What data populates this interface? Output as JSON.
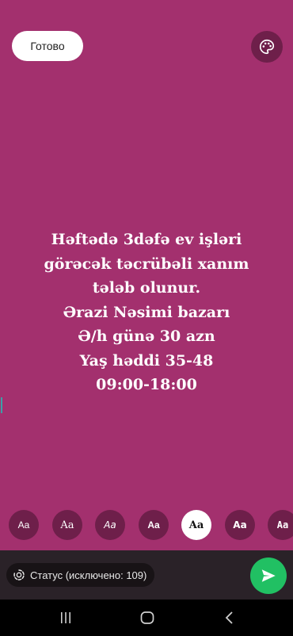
{
  "header": {
    "done_label": "Готово",
    "palette_icon": "palette-icon"
  },
  "status_text": {
    "lines": [
      "Həftədə 3dəfə ev işləri",
      "görəcək təcrübəli xanım",
      "tələb olunur.",
      "Ərazi Nəsimi bazarı",
      "Ə/h günə 30 azn",
      "Yaş həddi 35-48",
      "09:00-18:00"
    ],
    "background_color": "#a3306e",
    "text_color": "#ffffff"
  },
  "font_options": {
    "items": [
      "Aa",
      "Aa",
      "Aa",
      "Aa",
      "Aa",
      "Aa",
      "Aa"
    ],
    "selected_index": 4
  },
  "bottom": {
    "status_privacy_label": "Статус (исключено: 109)",
    "status_icon": "status-ring-icon",
    "send_icon": "send-icon",
    "send_color": "#21c063"
  },
  "nav": {
    "recents_icon": "recents-icon",
    "home_icon": "home-icon",
    "back_icon": "back-icon"
  }
}
